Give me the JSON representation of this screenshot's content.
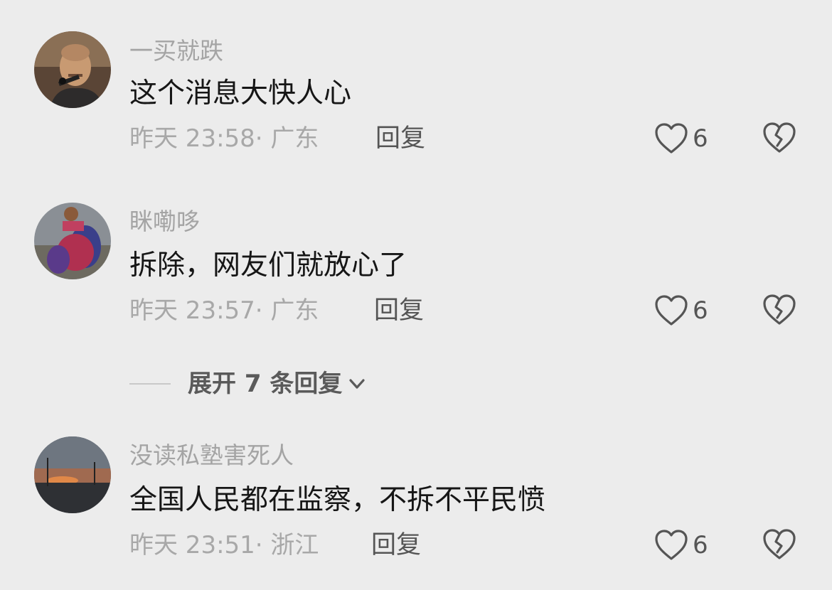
{
  "comments": [
    {
      "username": "一买就跌",
      "content": "这个消息大快人心",
      "meta": "昨天 23:58· 广东",
      "reply_label": "回复",
      "like_count": "6",
      "avatar_icon": "bald-man-photo"
    },
    {
      "username": "眯嘞哆",
      "content": "拆除，网友们就放心了",
      "meta": "昨天 23:57· 广东",
      "reply_label": "回复",
      "like_count": "6",
      "avatar_icon": "wrestler-photo"
    },
    {
      "username": "没读私塾害死人",
      "content": "全国人民都在监察，不拆不平民愤",
      "meta": "昨天 23:51· 浙江",
      "reply_label": "回复",
      "like_count": "6",
      "avatar_icon": "sunset-landscape-photo"
    }
  ],
  "expand_replies": {
    "label": "展开 7 条回复"
  },
  "icons": {
    "like": "heart-outline-icon",
    "dislike": "broken-heart-icon",
    "expand": "chevron-down-icon"
  },
  "colors": {
    "background": "#ececec",
    "username": "#a4a4a4",
    "content": "#161616",
    "meta": "#a8a8a8",
    "action": "#555555"
  }
}
